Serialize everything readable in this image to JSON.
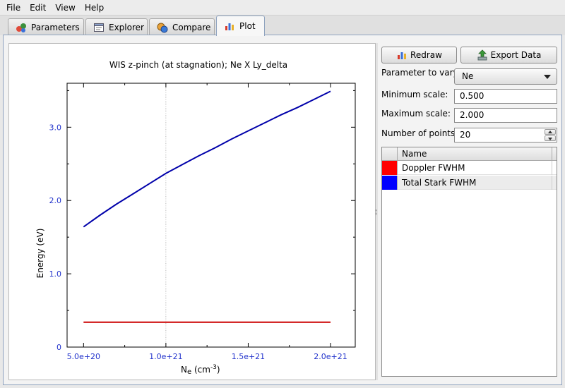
{
  "menu": {
    "file": "File",
    "edit": "Edit",
    "view": "View",
    "help": "Help"
  },
  "tabs": {
    "parameters": "Parameters",
    "explorer": "Explorer",
    "compare": "Compare",
    "plot": "Plot",
    "active": "Plot"
  },
  "controls": {
    "redraw_label": "Redraw",
    "export_label": "Export Data",
    "param_label": "Parameter to vary:",
    "param_value": "Ne",
    "min_label": "Minimum scale:",
    "min_value": "0.500",
    "max_label": "Maximum scale:",
    "max_value": "2.000",
    "points_label": "Number of points:",
    "points_value": "20"
  },
  "series_table": {
    "header": "Name",
    "rows": [
      {
        "name": "Doppler FWHM",
        "color": "#ff0000"
      },
      {
        "name": "Total Stark FWHM",
        "color": "#0000ff"
      }
    ]
  },
  "chart_data": {
    "type": "line",
    "title": "WIS z-pinch (at stagnation); Ne X Ly_delta",
    "xlabel_main": "N",
    "xlabel_sub": "e",
    "xlabel_unit": " (cm",
    "xlabel_exp": "-3",
    "xlabel_close": ")",
    "ylabel": "Energy (eV)",
    "xlim": [
      4e+20,
      2.15e+21
    ],
    "ylim": [
      0,
      3.6
    ],
    "xticks": [
      5e+20,
      1e+21,
      1.5e+21,
      2e+21
    ],
    "xtick_labels": [
      "5.0e+20",
      "1.0e+21",
      "1.5e+21",
      "2.0e+21"
    ],
    "xminor": [
      7.5e+20,
      1.25e+21,
      1.75e+21
    ],
    "yticks": [
      0,
      1.0,
      2.0,
      3.0
    ],
    "ytick_labels": [
      "0",
      "1.0",
      "2.0",
      "3.0"
    ],
    "yminor": [
      0.5,
      1.5,
      2.5,
      3.5
    ],
    "vline_x": 1e+21,
    "tick_label_color": "#2233cc",
    "series": [
      {
        "color": "#cc0000",
        "x": [
          5e+20,
          2e+21
        ],
        "y": [
          0.34,
          0.34
        ]
      },
      {
        "color": "#0000aa",
        "x": [
          5e+20,
          6e+20,
          7e+20,
          8e+20,
          9e+20,
          1e+21,
          1.1e+21,
          1.2e+21,
          1.3e+21,
          1.4e+21,
          1.5e+21,
          1.6e+21,
          1.7e+21,
          1.8e+21,
          1.9e+21,
          2e+21
        ],
        "y": [
          1.64,
          1.8,
          1.95,
          2.09,
          2.23,
          2.37,
          2.49,
          2.61,
          2.72,
          2.84,
          2.95,
          3.06,
          3.17,
          3.27,
          3.38,
          3.49
        ]
      }
    ]
  }
}
